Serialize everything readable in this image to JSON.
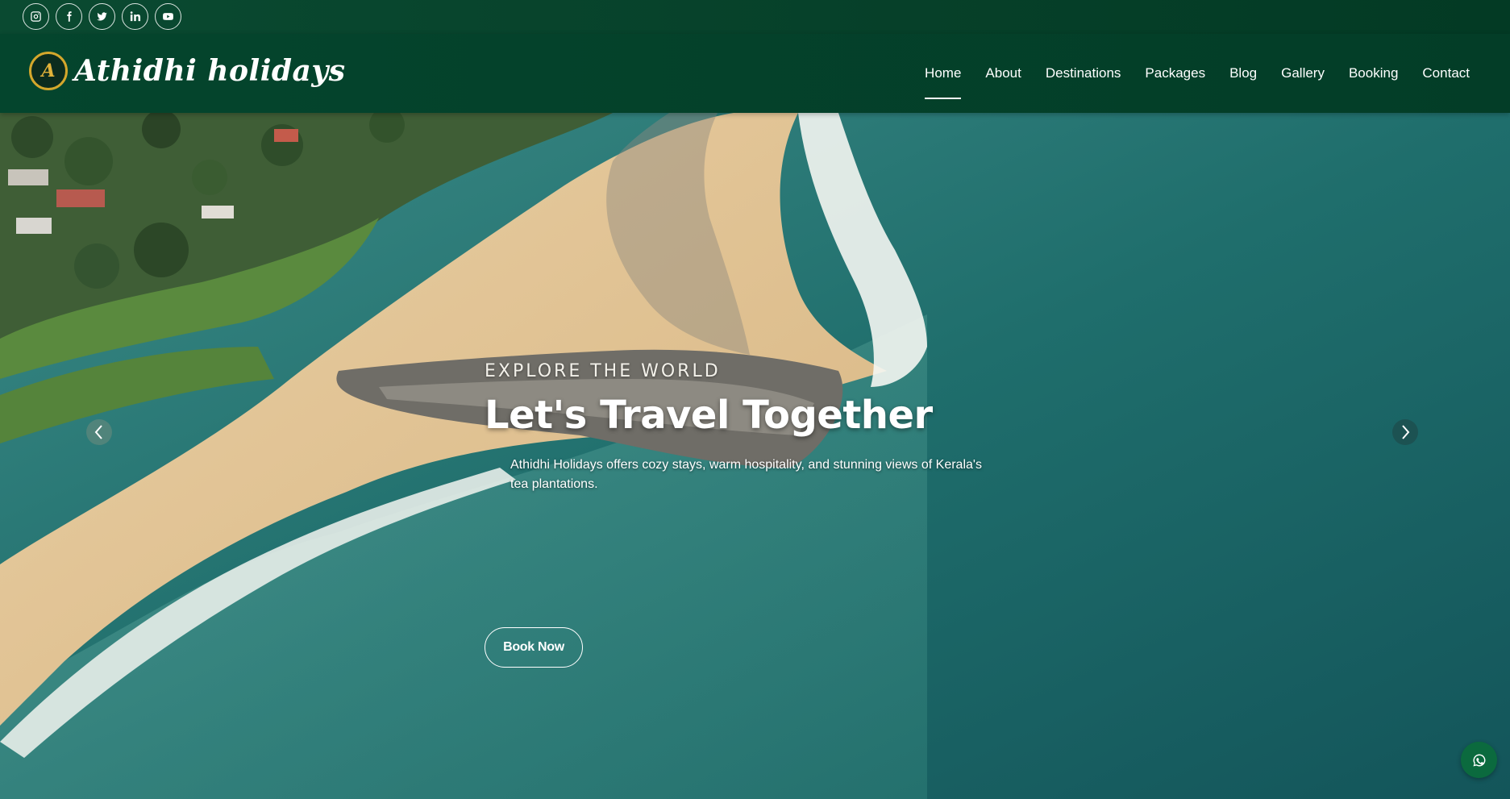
{
  "social": {
    "items": [
      {
        "name": "instagram",
        "icon": "instagram-icon"
      },
      {
        "name": "facebook",
        "icon": "facebook-icon"
      },
      {
        "name": "twitter",
        "icon": "twitter-icon"
      },
      {
        "name": "linkedin",
        "icon": "linkedin-icon"
      },
      {
        "name": "youtube",
        "icon": "youtube-icon"
      }
    ]
  },
  "brand": {
    "name": "Athidhi holidays",
    "logo_letter": "A",
    "logo_icon": "athidhi-logo-icon"
  },
  "nav": {
    "items": [
      {
        "label": "Home",
        "active": true
      },
      {
        "label": "About",
        "active": false
      },
      {
        "label": "Destinations",
        "active": false
      },
      {
        "label": "Packages",
        "active": false
      },
      {
        "label": "Blog",
        "active": false
      },
      {
        "label": "Gallery",
        "active": false
      },
      {
        "label": "Booking",
        "active": false
      },
      {
        "label": "Contact",
        "active": false
      }
    ]
  },
  "hero": {
    "eyebrow": "EXPLORE THE WORLD",
    "title": "Let's Travel Together",
    "description": "Athidhi Holidays offers cozy stays, warm hospitality, and stunning views of Kerala's tea plantations.",
    "cta_label": "Book Now",
    "prev_icon": "chevron-left-icon",
    "next_icon": "chevron-right-icon"
  },
  "floating": {
    "whatsapp_icon": "whatsapp-icon"
  },
  "colors": {
    "header_bg": "#04452d",
    "topbar_bg": "#0a4a31",
    "logo_gold": "#d4a72c",
    "whatsapp_green": "#0b6a3e",
    "sea": "#1d6f6b",
    "sand": "#e6c89a"
  }
}
